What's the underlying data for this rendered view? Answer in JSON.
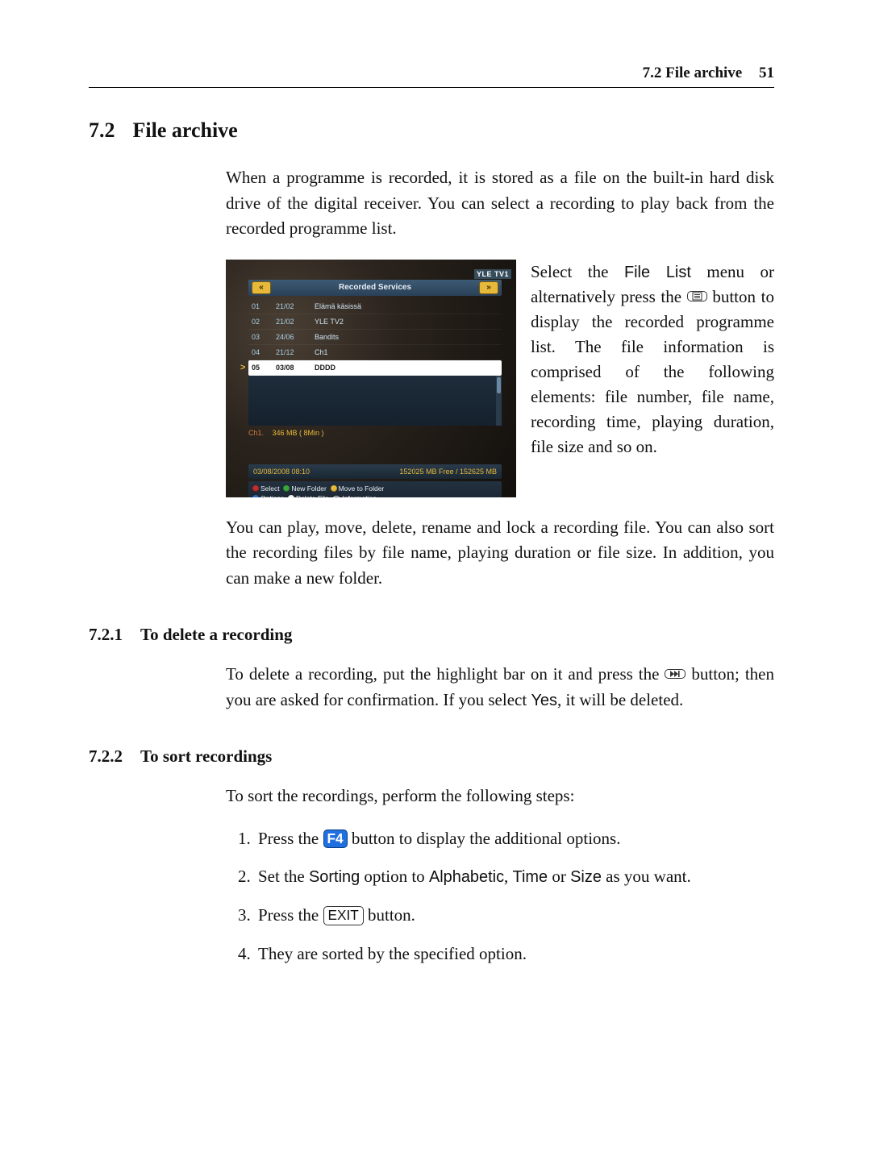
{
  "header": {
    "section_ref": "7.2 File archive",
    "page_number": "51"
  },
  "sec": {
    "num": "7.2",
    "title": "File archive",
    "intro": "When a programme is recorded, it is stored as a file on the built-in hard disk drive of the digital receiver. You can select a recording to play back from the recorded programme list.",
    "fig_text_pre": "Select the ",
    "fig_menu_name": "File List",
    "fig_text_mid": " menu or alternatively press the ",
    "fig_text_post": " button to display the recorded programme list. The file information is comprised of the following elements: file number, file name, recording time, playing duration, file size and so on.",
    "after_fig": "You can play, move, delete, rename and lock a recording file. You can also sort the recording files by file name, playing duration or file size. In addition, you can make a new folder."
  },
  "sub1": {
    "num": "7.2.1",
    "title": "To delete a recording",
    "p_pre_btn": "To delete a recording, put the highlight bar on it and press the ",
    "p_mid": " button; then you are asked for confirmation. If you select ",
    "yes_label": "Yes",
    "p_post": ", it will be deleted."
  },
  "sub2": {
    "num": "7.2.2",
    "title": "To sort recordings",
    "intro": "To sort the recordings, perform the following steps:",
    "steps": {
      "s1_pre": "Press the ",
      "s1_key": "F4",
      "s1_post": " button to display the additional options.",
      "s2_pre": "Set the ",
      "s2_opt": "Sorting",
      "s2_mid": " option to ",
      "s2_a": "Alphabetic",
      "s2_b": "Time",
      "s2_c": "Size",
      "s2_post": " as you want.",
      "s3_pre": "Press the ",
      "s3_key": "EXIT",
      "s3_post": " button.",
      "s4": "They are sorted by the specified option."
    }
  },
  "tv": {
    "channel_badge": "YLE TV1",
    "panel_title": "Recorded Services",
    "nav_left": "«",
    "nav_right": "»",
    "rows": [
      {
        "idx": "01",
        "date": "21/02",
        "name": "Elämä käsissä"
      },
      {
        "idx": "02",
        "date": "21/02",
        "name": "YLE TV2"
      },
      {
        "idx": "03",
        "date": "24/06",
        "name": "Bandits"
      },
      {
        "idx": "04",
        "date": "21/12",
        "name": "Ch1"
      },
      {
        "idx": "05",
        "date": "03/08",
        "name": "DDDD"
      }
    ],
    "selected_idx": 4,
    "info_channel": "Ch1.",
    "info_size": "346 MB ( 8Min )",
    "status_datetime": "03/08/2008 08:10",
    "status_disk": "152025 MB Free / 152625 MB",
    "legend": {
      "select": "Select",
      "new_folder": "New Folder",
      "move": "Move to Folder",
      "options": "Options",
      "delete": "Delete File",
      "info": "Information"
    }
  }
}
